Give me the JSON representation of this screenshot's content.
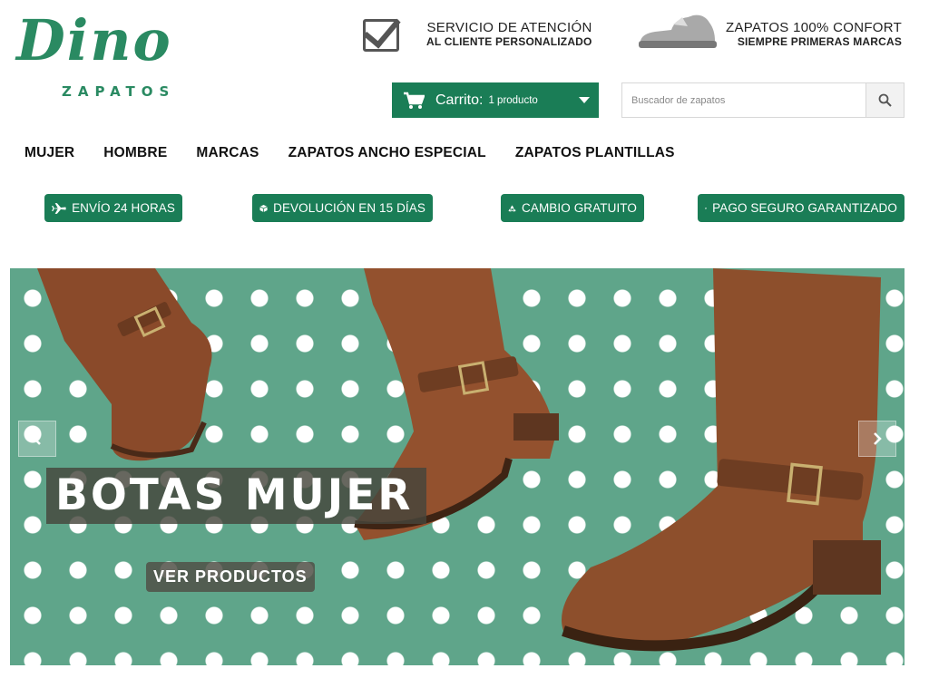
{
  "logo": {
    "main": "Dino",
    "sub": "ZAPATOS"
  },
  "promos": [
    {
      "title": "SERVICIO DE ATENCIÓN",
      "subtitle": "AL CLIENTE PERSONALIZADO",
      "icon": "checkbox-icon"
    },
    {
      "title": "ZAPATOS 100% CONFORT",
      "subtitle": "SIEMPRE PRIMERAS MARCAS",
      "icon": "shoe-icon"
    }
  ],
  "cart": {
    "label": "Carrito:",
    "count": "1 producto",
    "icon": "cart-icon"
  },
  "search": {
    "placeholder": "Buscador de zapatos",
    "value": "",
    "icon": "search-icon"
  },
  "nav": [
    "MUJER",
    "HOMBRE",
    "MARCAS",
    "ZAPATOS ANCHO ESPECIAL",
    "ZAPATOS PLANTILLAS"
  ],
  "features": [
    {
      "label": "ENVÍO 24 HORAS",
      "icon": "airplane-icon"
    },
    {
      "label": "DEVOLUCIÓN EN 15 DÍAS",
      "icon": "box-icon"
    },
    {
      "label": "CAMBIO GRATUITO",
      "icon": "recycle-icon"
    },
    {
      "label": "PAGO SEGURO GARANTIZADO",
      "icon": "credit-card-icon"
    }
  ],
  "banner": {
    "title": "BOTAS MUJER",
    "cta": "VER PRODUCTOS"
  },
  "colors": {
    "brand": "#1a7d56",
    "logo": "#2a8a62",
    "banner_bg": "#5fa58a",
    "boot": "#8a4a2a"
  }
}
